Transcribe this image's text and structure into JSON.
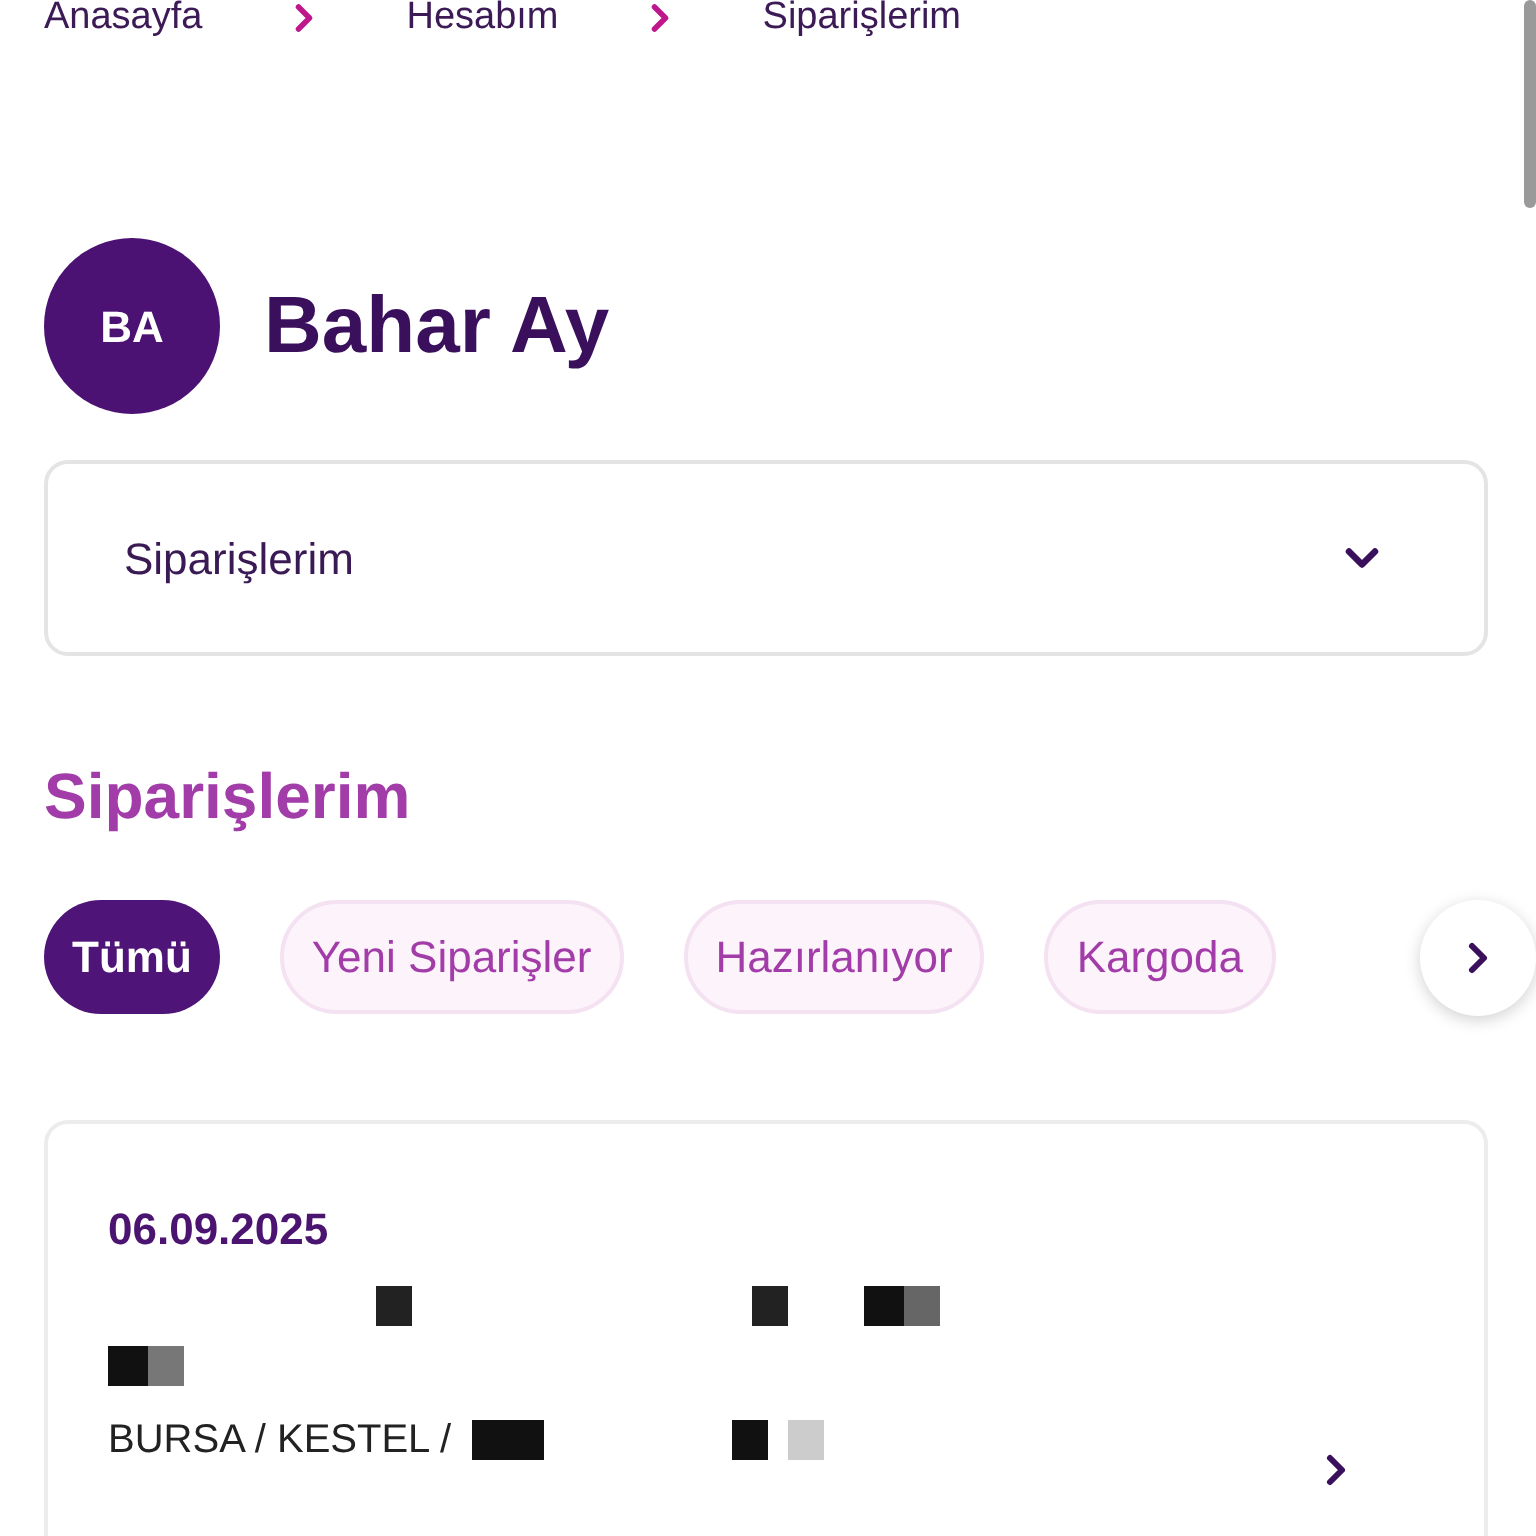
{
  "breadcrumb": [
    {
      "label": "Anasayfa"
    },
    {
      "label": "Hesabım"
    },
    {
      "label": "Siparişlerim"
    }
  ],
  "profile": {
    "initials": "BA",
    "name": "Bahar Ay"
  },
  "menu_select": {
    "value": "Siparişlerim"
  },
  "orders_heading": "Siparişlerim",
  "filter_tabs": [
    {
      "label": "Tümü",
      "selected": true
    },
    {
      "label": "Yeni Siparişler",
      "selected": false
    },
    {
      "label": "Hazırlanıyor",
      "selected": false
    },
    {
      "label": "Kargoda",
      "selected": false
    }
  ],
  "orders": [
    {
      "date": "06.09.2025",
      "address": "BURSA / KESTEL /"
    }
  ]
}
